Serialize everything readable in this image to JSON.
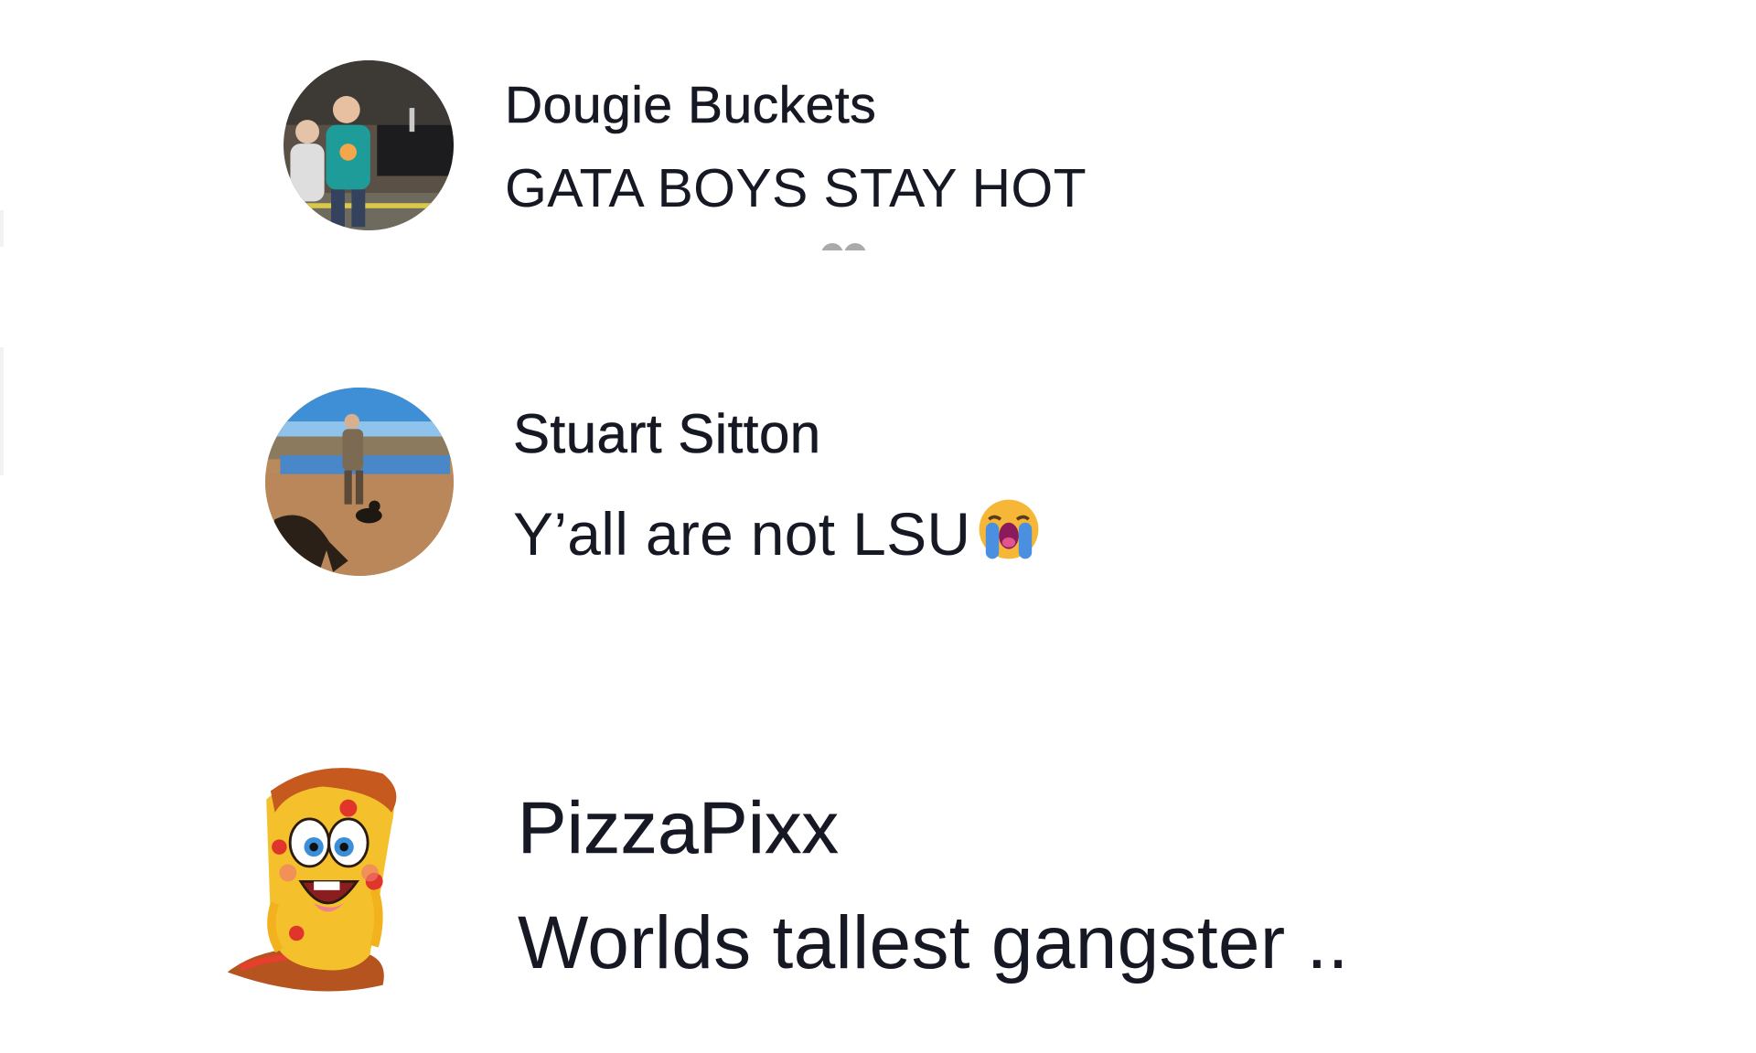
{
  "comments": [
    {
      "username": "Dougie Buckets",
      "text": "GATA BOYS STAY HOT",
      "avatar_icon": "person-photo-avatar"
    },
    {
      "username": "Stuart Sitton",
      "text": "Y’all are not LSU",
      "emoji_icon": "loudly-crying-face-icon",
      "avatar_icon": "person-outdoors-photo-avatar"
    },
    {
      "username": "PizzaPixx",
      "text": "Worlds tallest gangster ..",
      "avatar_icon": "pizza-slice-cartoon-avatar"
    }
  ],
  "colors": {
    "text": "#161823",
    "background": "#ffffff"
  }
}
